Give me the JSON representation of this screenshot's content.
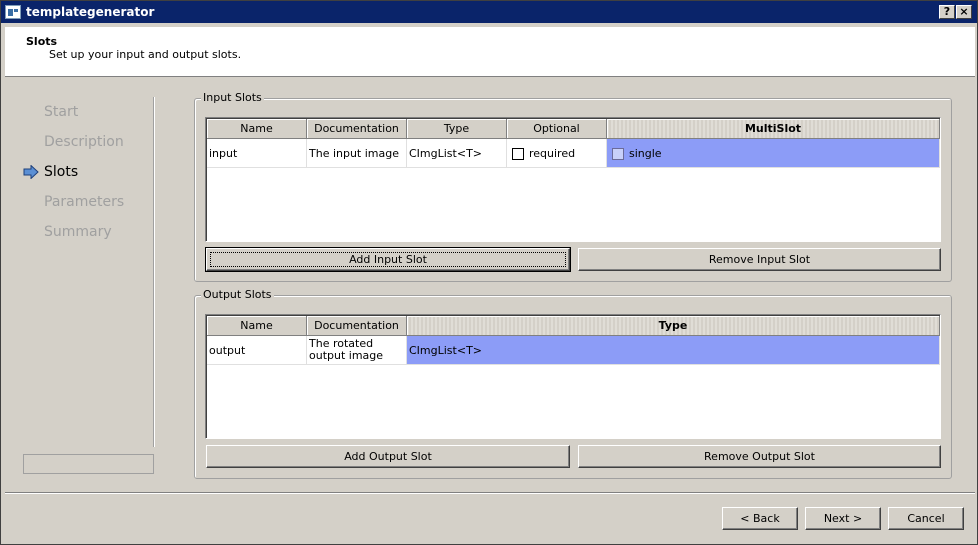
{
  "window": {
    "title": "templategenerator",
    "help_label": "?",
    "close_label": "×"
  },
  "header": {
    "title": "Slots",
    "subtitle": "Set up your input and output slots."
  },
  "nav": {
    "items": [
      {
        "label": "Start",
        "active": false
      },
      {
        "label": "Description",
        "active": false
      },
      {
        "label": "Slots",
        "active": true
      },
      {
        "label": "Parameters",
        "active": false
      },
      {
        "label": "Summary",
        "active": false
      }
    ],
    "arrow_icon": "arrow-right-icon"
  },
  "input_slots": {
    "title": "Input Slots",
    "columns": [
      "Name",
      "Documentation",
      "Type",
      "Optional",
      "MultiSlot"
    ],
    "rows": [
      {
        "name": "input",
        "documentation": "The input image",
        "type": "CImgList<T>",
        "optional": "required",
        "multislot": "single"
      }
    ],
    "add_label": "Add Input Slot",
    "remove_label": "Remove Input Slot"
  },
  "output_slots": {
    "title": "Output Slots",
    "columns": [
      "Name",
      "Documentation",
      "Type"
    ],
    "rows": [
      {
        "name": "output",
        "documentation": "The rotated output image",
        "type": "CImgList<T>"
      }
    ],
    "add_label": "Add Output Slot",
    "remove_label": "Remove Output Slot"
  },
  "footer": {
    "back_label": "< Back",
    "next_label": "Next >",
    "cancel_label": "Cancel"
  },
  "colors": {
    "titlebar": "#0a246a",
    "selection": "#8c9cf7",
    "dialog": "#d4d0c8"
  }
}
